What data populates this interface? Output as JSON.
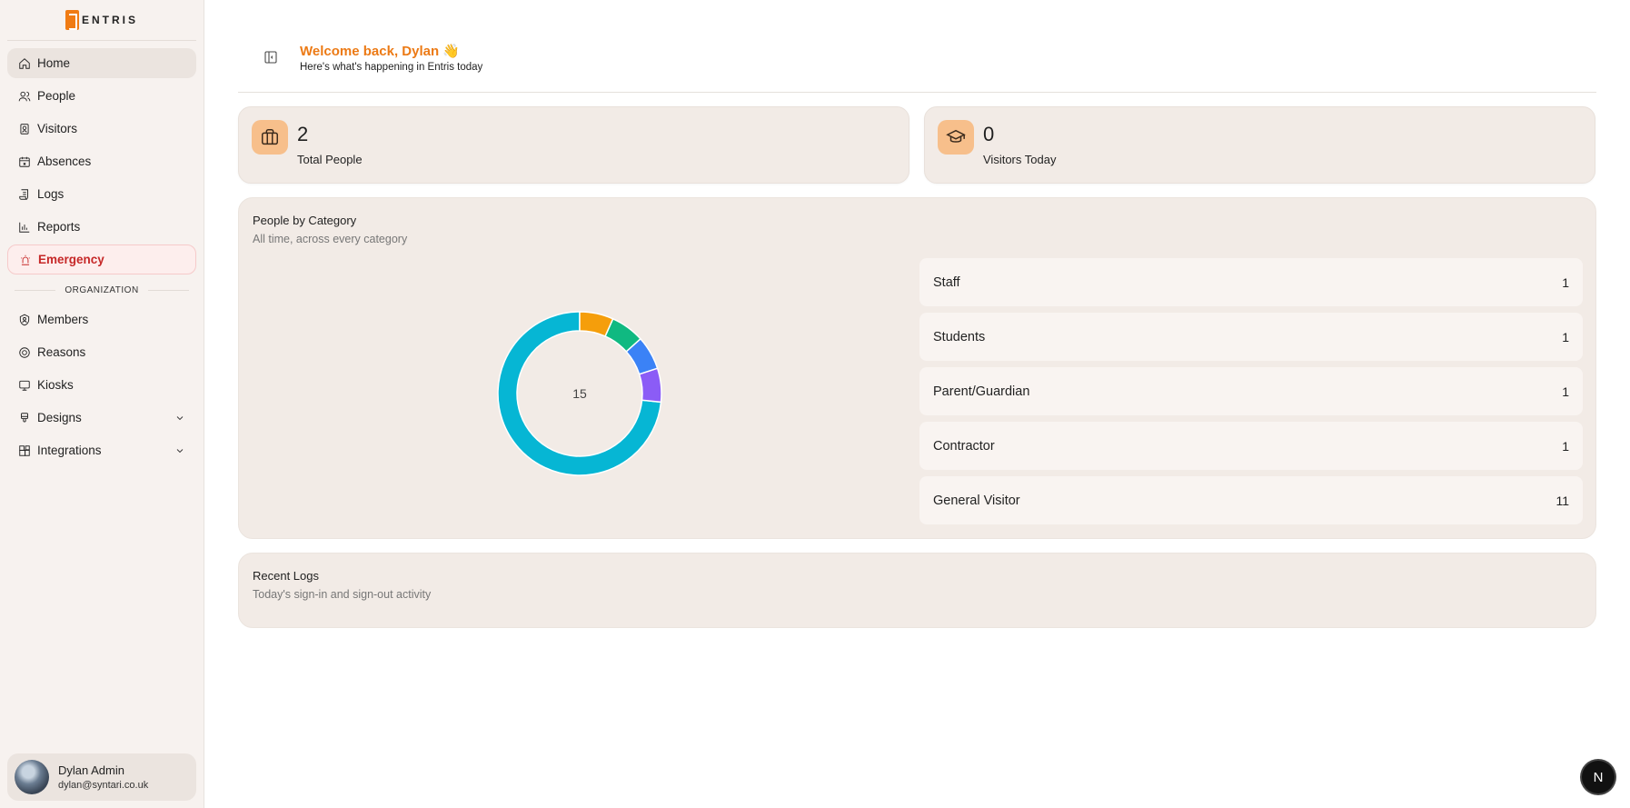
{
  "brand": {
    "name": "ENTRIS",
    "accent": "#f07b13"
  },
  "sidebar": {
    "nav": [
      {
        "label": "Home",
        "icon": "home-icon",
        "active": true
      },
      {
        "label": "People",
        "icon": "users-icon"
      },
      {
        "label": "Visitors",
        "icon": "badge-icon"
      },
      {
        "label": "Absences",
        "icon": "calendar-icon"
      },
      {
        "label": "Logs",
        "icon": "scroll-icon"
      },
      {
        "label": "Reports",
        "icon": "bar-chart-icon"
      },
      {
        "label": "Emergency",
        "icon": "siren-icon"
      }
    ],
    "section_label": "ORGANIZATION",
    "org": [
      {
        "label": "Members",
        "icon": "shield-user-icon"
      },
      {
        "label": "Reasons",
        "icon": "target-icon"
      },
      {
        "label": "Kiosks",
        "icon": "monitor-icon"
      },
      {
        "label": "Designs",
        "icon": "brush-icon"
      },
      {
        "label": "Integrations",
        "icon": "blocks-icon"
      }
    ],
    "user": {
      "name": "Dylan Admin",
      "email": "dylan@syntari.co.uk"
    }
  },
  "header": {
    "welcome": "Welcome back, Dylan 👋",
    "subtitle": "Here's what's happening in Entris today"
  },
  "stats": [
    {
      "value": "2",
      "label": "Total People",
      "icon": "briefcase-icon"
    },
    {
      "value": "0",
      "label": "Visitors Today",
      "icon": "graduation-cap-icon"
    }
  ],
  "category_panel": {
    "title": "People by Category",
    "subtitle": "All time, across every category",
    "total": "15",
    "categories": [
      {
        "name": "Staff",
        "count": "1"
      },
      {
        "name": "Students",
        "count": "1"
      },
      {
        "name": "Parent/Guardian",
        "count": "1"
      },
      {
        "name": "Contractor",
        "count": "1"
      },
      {
        "name": "General Visitor",
        "count": "11"
      }
    ]
  },
  "chart_data": {
    "type": "pie",
    "categories": [
      "Staff",
      "Students",
      "Parent/Guardian",
      "Contractor",
      "General Visitor"
    ],
    "values": [
      1,
      1,
      1,
      1,
      11
    ],
    "colors": [
      "#f59e0b",
      "#10b981",
      "#3b82f6",
      "#8b5cf6",
      "#06b6d4"
    ]
  },
  "recent_logs": {
    "title": "Recent Logs",
    "subtitle": "Today's sign-in and sign-out activity"
  },
  "fab_label": "N"
}
